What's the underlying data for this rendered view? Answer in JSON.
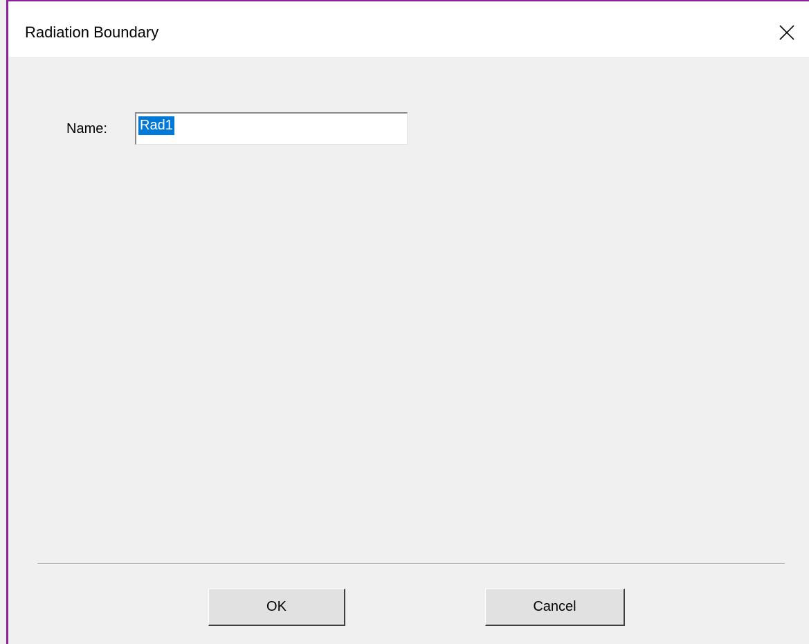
{
  "window": {
    "title": "Radiation Boundary",
    "close_icon": "close-icon",
    "border_color": "#8e1f9a"
  },
  "form": {
    "name_label": "Name:",
    "name_value": "Rad1",
    "selection_color": "#0078d7"
  },
  "buttons": {
    "ok_label": "OK",
    "cancel_label": "Cancel"
  }
}
